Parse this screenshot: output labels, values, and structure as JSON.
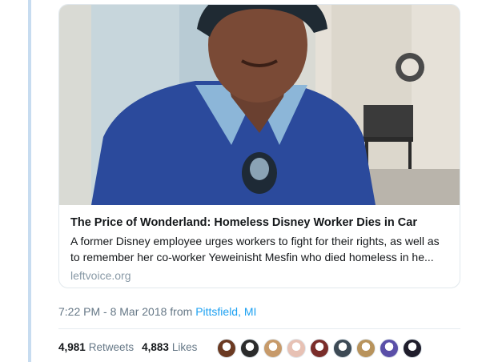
{
  "card": {
    "image_alt": "Photo of a smiling woman in a blue sweater and cap",
    "title": "The Price of Wonderland: Homeless Disney Worker Dies in Car",
    "description": "A former Disney employee urges workers to fight for their rights, as well as to remember her co-worker Yeweinisht Mesfin who died homeless in he...",
    "domain": "leftvoice.org"
  },
  "meta": {
    "time": "7:22 PM - 8 Mar 2018",
    "from_label": "from",
    "location": "Pittsfield, MI"
  },
  "stats": {
    "retweets_count": "4,981",
    "retweets_label": "Retweets",
    "likes_count": "4,883",
    "likes_label": "Likes"
  },
  "liker_avatars": [
    {
      "color": "#6b3a22"
    },
    {
      "color": "#2b2b2b"
    },
    {
      "color": "#c79a6a"
    },
    {
      "color": "#e7c1b4"
    },
    {
      "color": "#7a2d2a"
    },
    {
      "color": "#3d4a55"
    },
    {
      "color": "#b8935c"
    },
    {
      "color": "#5a4fa8"
    },
    {
      "color": "#1f1d2b"
    }
  ],
  "colors": {
    "link": "#1da1f2",
    "muted": "#657786",
    "sweater": "#2b4a9c"
  }
}
